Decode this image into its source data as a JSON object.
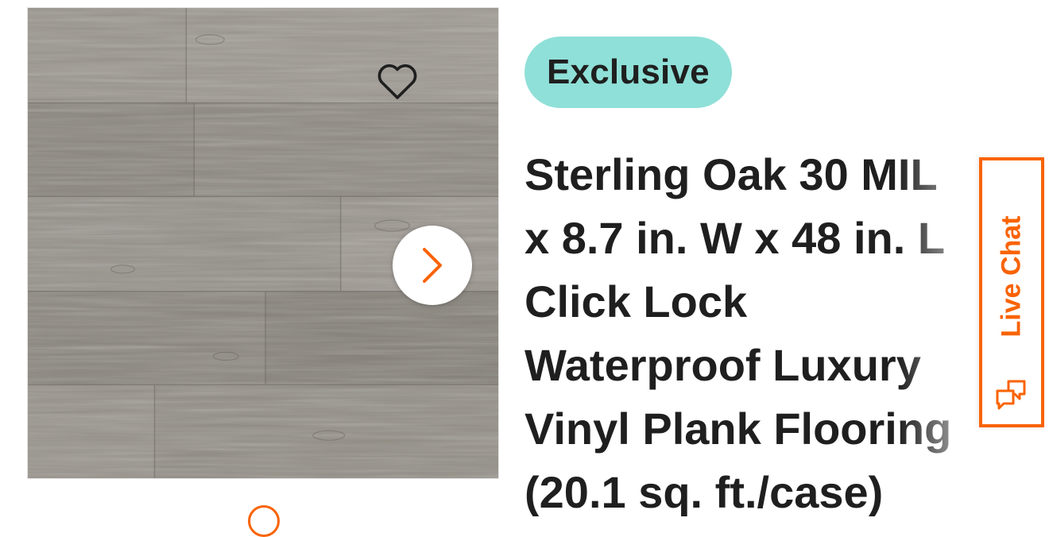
{
  "product": {
    "badge": "Exclusive",
    "title": "Sterling Oak 30 MIL\nx 8.7 in. W x 48 in. L\nClick Lock\nWaterproof Luxury\nVinyl Plank Flooring\n(20.1 sq. ft./case)"
  },
  "live_chat": {
    "label": "Live Chat"
  },
  "icons": {
    "favorite": "heart-icon",
    "next_image": "chevron-right-icon",
    "chat": "chat-bubbles-icon"
  },
  "colors": {
    "accent": "#f96302",
    "badge_bg": "#8fe0d8",
    "text": "#1f1f1f"
  }
}
